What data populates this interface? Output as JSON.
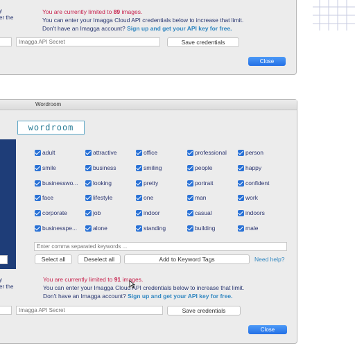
{
  "top_section": {
    "side_label_1": "y",
    "side_label_2": "er the",
    "limit_prefix": "You are currently limited to",
    "limit_count": "89",
    "limit_suffix": "images.",
    "line2": "You can enter your Imagga Cloud API credentials below to increase that limit.",
    "line3_prefix": "Don't have an Imagga account?",
    "line3_link": "Sign up and get your API key for free.",
    "api_secret_placeholder": "Imagga API Secret",
    "save_button": "Save credentials",
    "close_button": "Close"
  },
  "window": {
    "title": "Wordroom",
    "logo_text": "wordroom"
  },
  "keywords": [
    [
      "adult",
      "attractive",
      "office",
      "professional",
      "person"
    ],
    [
      "smile",
      "business",
      "smiling",
      "people",
      "happy"
    ],
    [
      "businesswo...",
      "looking",
      "pretty",
      "portrait",
      "confident"
    ],
    [
      "face",
      "lifestyle",
      "one",
      "man",
      "work"
    ],
    [
      "corporate",
      "job",
      "indoor",
      "casual",
      "indoors"
    ],
    [
      "businesspe...",
      "alone",
      "standing",
      "building",
      "male"
    ]
  ],
  "keyword_input_placeholder": "Enter comma separated keywords ...",
  "buttons": {
    "select_all": "Select all",
    "deselect_all": "Deselect all",
    "add_to_tags": "Add to Keyword Tags",
    "need_help": "Need help?"
  },
  "bottom_section": {
    "side_label_1": "y",
    "side_label_2": "er the",
    "limit_prefix": "You are currently limited to",
    "limit_count": "91",
    "limit_suffix": "images.",
    "line2": "You can enter your Imagga Cloud API credentials below to increase that limit.",
    "line3_prefix": "Don't have an Imagga account?",
    "line3_link": "Sign up and get your API key for free.",
    "api_secret_placeholder": "Imagga API Secret",
    "save_button": "Save credentials",
    "close_button": "Close"
  },
  "colors": {
    "accent_blue": "#2a72d6",
    "limit_red": "#c8234e",
    "link_blue": "#2f86c0",
    "sidebar_navy": "#1e3d78"
  }
}
